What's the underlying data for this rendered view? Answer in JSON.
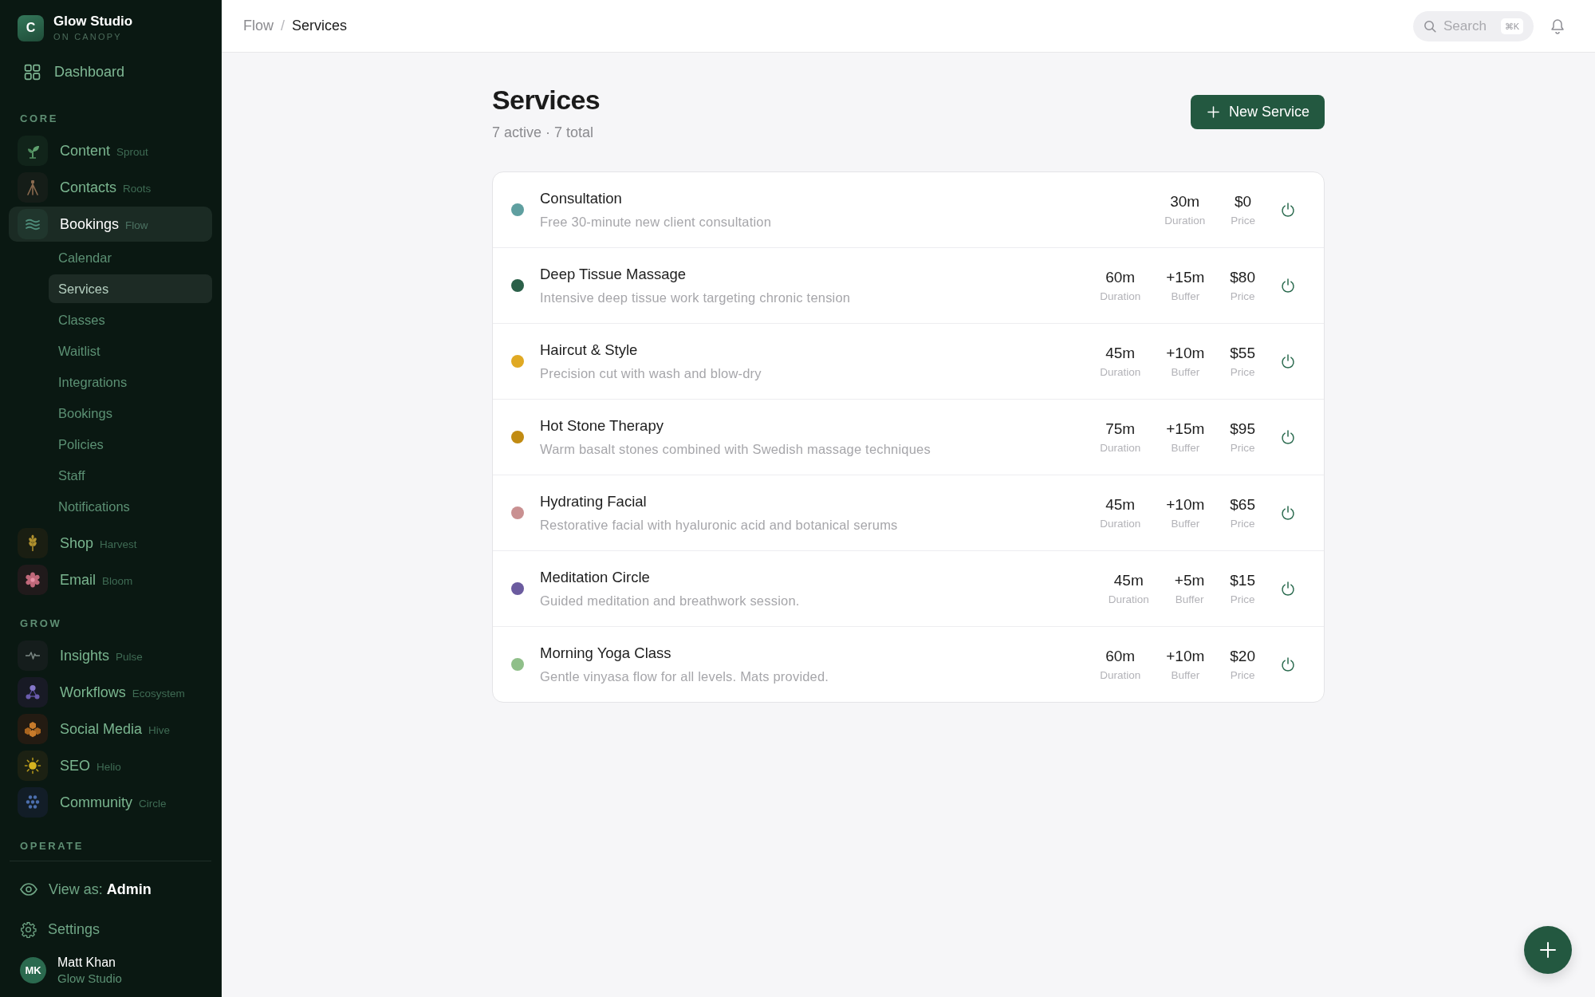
{
  "sidebar": {
    "brand": {
      "logo": "C",
      "name": "Glow Studio",
      "subtitle": "ON CANOPY"
    },
    "dashboard": {
      "label": "Dashboard",
      "selected": false
    },
    "sections": [
      {
        "title": "CORE",
        "items": [
          {
            "label": "Content",
            "tag": "Sprout",
            "selected": false
          },
          {
            "label": "Contacts",
            "tag": "Roots",
            "selected": false
          },
          {
            "label": "Bookings",
            "tag": "Flow",
            "selected": true,
            "children": [
              {
                "label": "Calendar",
                "selected": false
              },
              {
                "label": "Services",
                "selected": true
              },
              {
                "label": "Classes",
                "selected": false
              },
              {
                "label": "Waitlist",
                "selected": false
              },
              {
                "label": "Integrations",
                "selected": false
              },
              {
                "label": "Bookings",
                "selected": false
              },
              {
                "label": "Policies",
                "selected": false
              },
              {
                "label": "Staff",
                "selected": false
              },
              {
                "label": "Notifications",
                "selected": false
              }
            ]
          },
          {
            "label": "Shop",
            "tag": "Harvest",
            "selected": false
          },
          {
            "label": "Email",
            "tag": "Bloom",
            "selected": false
          }
        ]
      },
      {
        "title": "GROW",
        "items": [
          {
            "label": "Insights",
            "tag": "Pulse",
            "selected": false
          },
          {
            "label": "Workflows",
            "tag": "Ecosystem",
            "selected": false
          },
          {
            "label": "Social Media",
            "tag": "Hive",
            "selected": false
          },
          {
            "label": "SEO",
            "tag": "Helio",
            "selected": false
          },
          {
            "label": "Community",
            "tag": "Circle",
            "selected": false
          }
        ]
      },
      {
        "title": "OPERATE"
      }
    ],
    "view_as": "View as: **Admin**",
    "settings": {
      "label": "Settings"
    },
    "user": {
      "initials": "MK",
      "name": "Matt Khan",
      "org": "Glow Studio"
    }
  },
  "header": {
    "breadcrumb": [
      {
        "label": "Flow",
        "current": false
      },
      {
        "label": "Services",
        "current": true
      }
    ],
    "separator": "/",
    "search": {
      "placeholder": "Search",
      "shortcut": "⌘K"
    }
  },
  "page": {
    "title": "Services",
    "summary": "7 active · 7 total",
    "new_button": {
      "label": "New Service"
    }
  },
  "services": [
    {
      "name": "Consultation",
      "description": "Free 30-minute new client consultation",
      "color": "#5f9fa0",
      "active": true,
      "stats": [
        {
          "value": "30m",
          "label": "Duration"
        },
        {
          "value": "$0",
          "label": "Price"
        }
      ]
    },
    {
      "name": "Deep Tissue Massage",
      "description": "Intensive deep tissue work targeting chronic tension",
      "color": "#2b6049",
      "active": true,
      "stats": [
        {
          "value": "60m",
          "label": "Duration"
        },
        {
          "value": "+15m",
          "label": "Buffer"
        },
        {
          "value": "$80",
          "label": "Price"
        }
      ]
    },
    {
      "name": "Haircut & Style",
      "description": "Precision cut with wash and blow-dry",
      "color": "#e0a923",
      "active": true,
      "stats": [
        {
          "value": "45m",
          "label": "Duration"
        },
        {
          "value": "+10m",
          "label": "Buffer"
        },
        {
          "value": "$55",
          "label": "Price"
        }
      ]
    },
    {
      "name": "Hot Stone Therapy",
      "description": "Warm basalt stones combined with Swedish massage techniques",
      "color": "#c18b12",
      "active": true,
      "stats": [
        {
          "value": "75m",
          "label": "Duration"
        },
        {
          "value": "+15m",
          "label": "Buffer"
        },
        {
          "value": "$95",
          "label": "Price"
        }
      ]
    },
    {
      "name": "Hydrating Facial",
      "description": "Restorative facial with hyaluronic acid and botanical serums",
      "color": "#c99091",
      "active": true,
      "stats": [
        {
          "value": "45m",
          "label": "Duration"
        },
        {
          "value": "+10m",
          "label": "Buffer"
        },
        {
          "value": "$65",
          "label": "Price"
        }
      ]
    },
    {
      "name": "Meditation Circle",
      "description": "Guided meditation and breathwork session.",
      "color": "#6b5b9f",
      "active": true,
      "stats": [
        {
          "value": "45m",
          "label": "Duration"
        },
        {
          "value": "+5m",
          "label": "Buffer"
        },
        {
          "value": "$15",
          "label": "Price"
        }
      ]
    },
    {
      "name": "Morning Yoga Class",
      "description": "Gentle vinyasa flow for all levels. Mats provided.",
      "color": "#8fbf89",
      "active": true,
      "stats": [
        {
          "value": "60m",
          "label": "Duration"
        },
        {
          "value": "+10m",
          "label": "Buffer"
        },
        {
          "value": "$20",
          "label": "Price"
        }
      ]
    }
  ]
}
